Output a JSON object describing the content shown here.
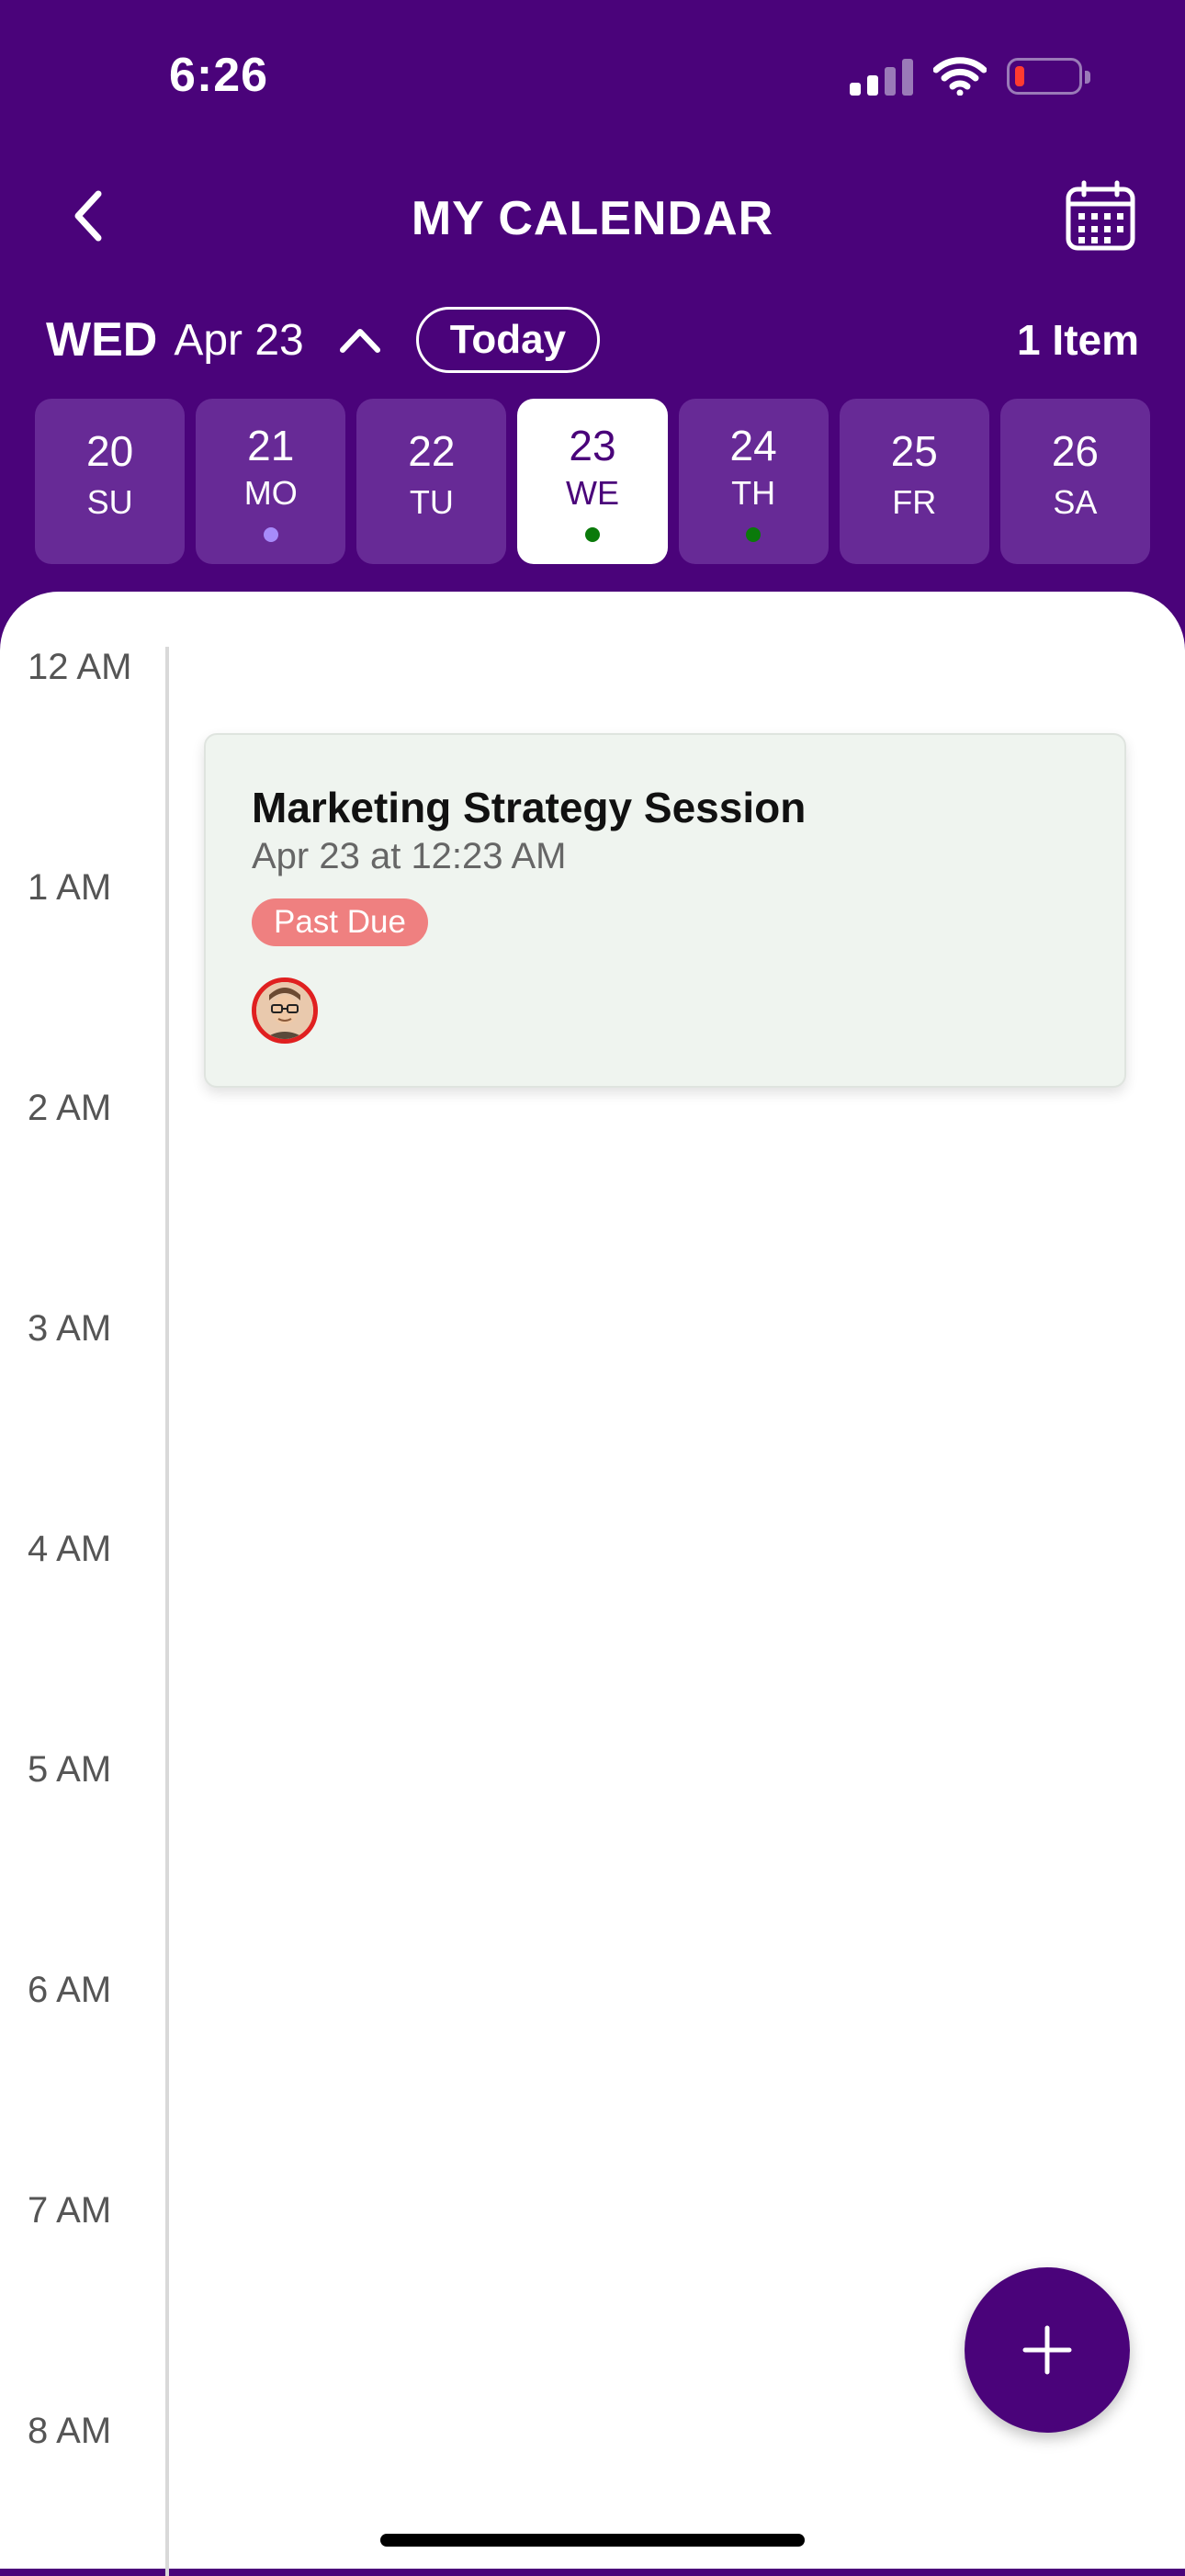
{
  "status_bar": {
    "time": "6:26",
    "battery_level": "low",
    "battery_color": "#ff3b30"
  },
  "header": {
    "title": "MY CALENDAR",
    "back_icon": "chevron-left-icon",
    "calendar_icon": "calendar-grid-icon"
  },
  "date_row": {
    "day_of_week": "WED",
    "date": "Apr 23",
    "collapse_icon": "chevron-up-icon",
    "today_label": "Today",
    "item_count": "1 Item"
  },
  "week": [
    {
      "num": "20",
      "abbr": "SU",
      "dot": null
    },
    {
      "num": "21",
      "abbr": "MO",
      "dot": "#a78bfa"
    },
    {
      "num": "22",
      "abbr": "TU",
      "dot": null
    },
    {
      "num": "23",
      "abbr": "WE",
      "dot": "#0a7a0a",
      "selected": true
    },
    {
      "num": "24",
      "abbr": "TH",
      "dot": "#0a7a0a"
    },
    {
      "num": "25",
      "abbr": "FR",
      "dot": null
    },
    {
      "num": "26",
      "abbr": "SA",
      "dot": null
    }
  ],
  "timeline": {
    "hours": [
      "12 AM",
      "1 AM",
      "2 AM",
      "3 AM",
      "4 AM",
      "5 AM",
      "6 AM",
      "7 AM",
      "8 AM"
    ]
  },
  "event": {
    "title": "Marketing Strategy Session",
    "time": "Apr 23 at 12:23 AM",
    "status": "Past Due"
  },
  "fab": {
    "icon": "plus-icon"
  },
  "colors": {
    "brand": "#4a037a",
    "past_due": "#ef8080",
    "card_bg": "#eff4ef"
  }
}
